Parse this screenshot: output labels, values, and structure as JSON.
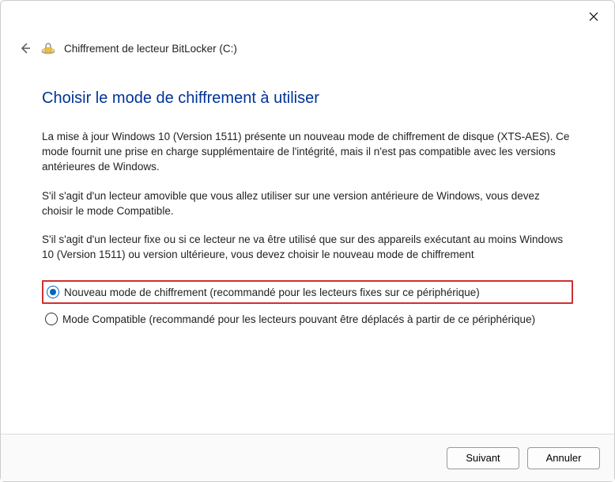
{
  "window": {
    "title": "Chiffrement de lecteur BitLocker (C:)"
  },
  "content": {
    "heading": "Choisir le mode de chiffrement à utiliser",
    "paragraph1": "La mise à jour Windows 10 (Version 1511) présente un nouveau mode de chiffrement de disque (XTS-AES). Ce mode fournit une prise en charge supplémentaire de l'intégrité, mais il n'est pas compatible avec les versions antérieures de Windows.",
    "paragraph2": "S'il s'agit d'un lecteur amovible que vous allez utiliser sur une version antérieure de Windows, vous devez choisir le mode Compatible.",
    "paragraph3": "S'il s'agit d'un lecteur fixe ou si ce lecteur ne va être utilisé que sur des appareils exécutant au moins Windows 10 (Version 1511) ou version ultérieure, vous devez choisir le nouveau mode de chiffrement"
  },
  "options": {
    "option1": {
      "label": "Nouveau mode de chiffrement (recommandé pour les lecteurs fixes sur ce périphérique)",
      "selected": true,
      "highlighted": true
    },
    "option2": {
      "label": "Mode Compatible (recommandé pour les lecteurs pouvant être déplacés à partir de ce périphérique)",
      "selected": false,
      "highlighted": false
    }
  },
  "footer": {
    "next": "Suivant",
    "cancel": "Annuler"
  }
}
